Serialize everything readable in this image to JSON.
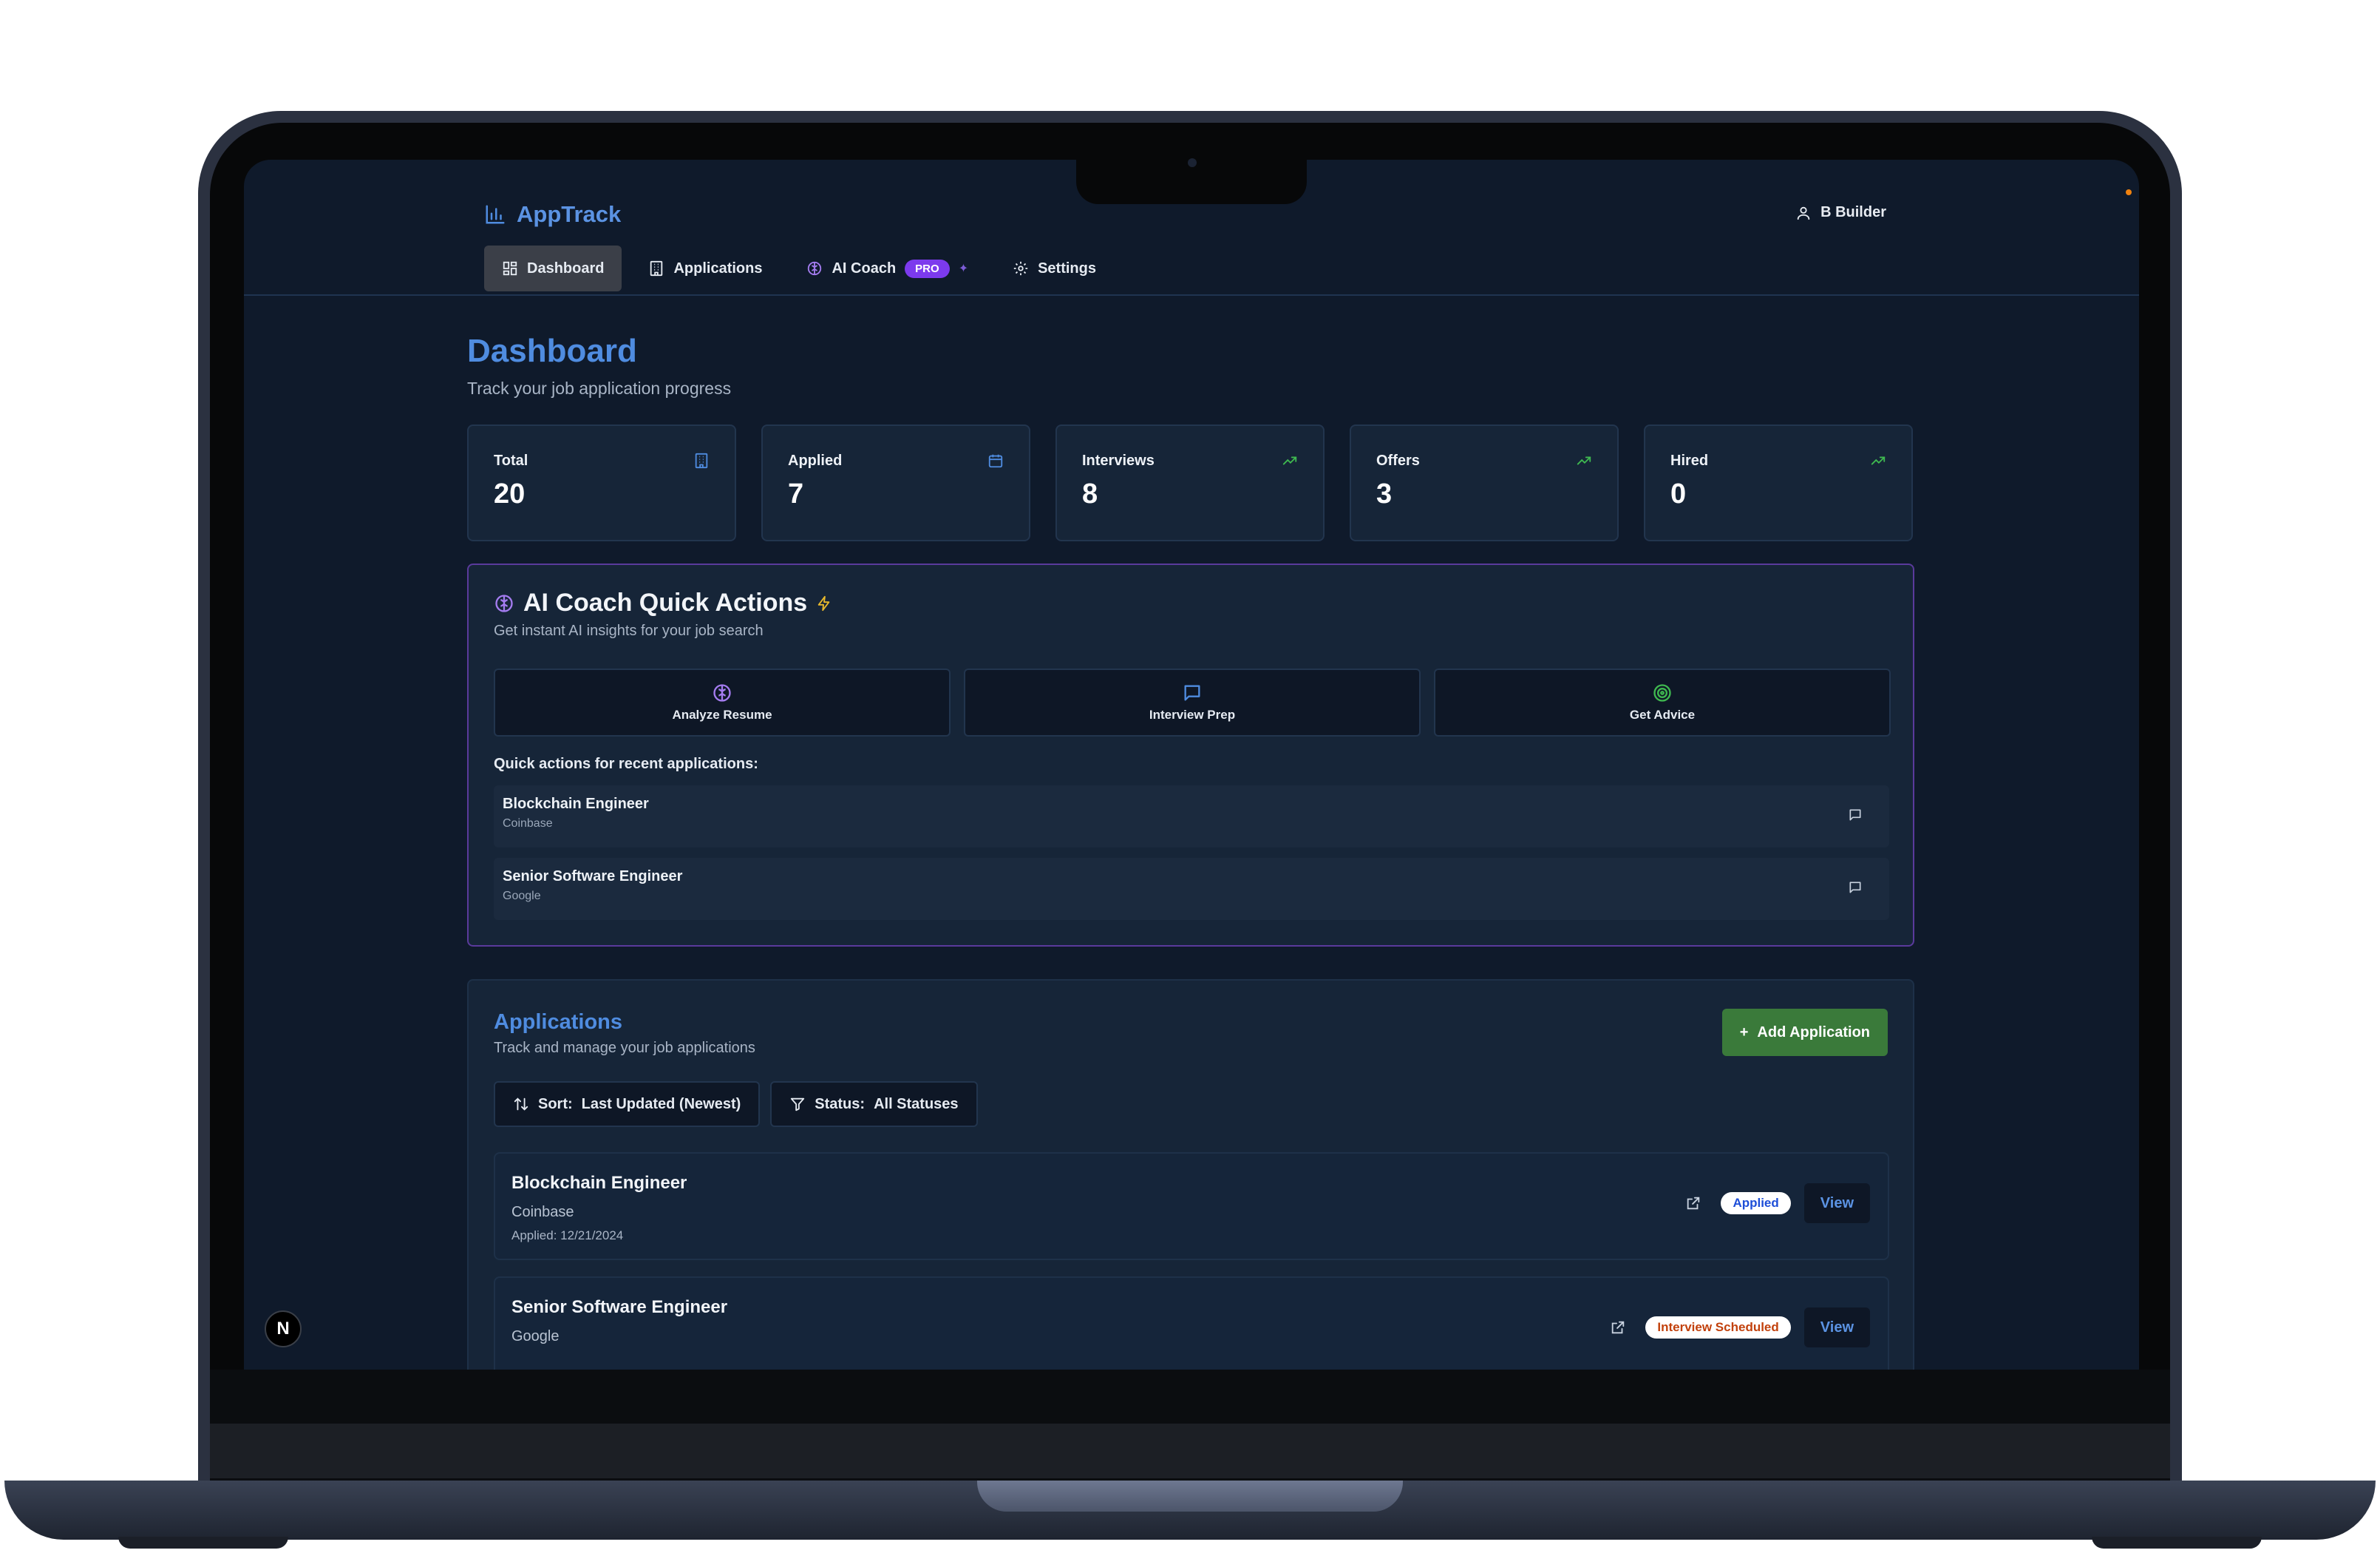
{
  "app": {
    "name": "AppTrack",
    "user_name": "B Builder"
  },
  "nav": {
    "items": [
      {
        "label": "Dashboard",
        "icon": "dashboard-grid-icon",
        "active": true
      },
      {
        "label": "Applications",
        "icon": "building-icon",
        "active": false
      },
      {
        "label": "AI Coach",
        "icon": "brain-icon",
        "badge": "PRO",
        "active": false
      },
      {
        "label": "Settings",
        "icon": "gear-icon",
        "active": false
      }
    ]
  },
  "page": {
    "title": "Dashboard",
    "subtitle": "Track your job application progress"
  },
  "stats": [
    {
      "label": "Total",
      "value": "20",
      "icon": "building-icon",
      "icon_color": "#4f8ce0"
    },
    {
      "label": "Applied",
      "value": "7",
      "icon": "calendar-icon",
      "icon_color": "#4f8ce0"
    },
    {
      "label": "Interviews",
      "value": "8",
      "icon": "trending-up-icon",
      "icon_color": "#3fb950"
    },
    {
      "label": "Offers",
      "value": "3",
      "icon": "trending-up-icon",
      "icon_color": "#3fb950"
    },
    {
      "label": "Hired",
      "value": "0",
      "icon": "trending-up-icon",
      "icon_color": "#3fb950"
    }
  ],
  "coach": {
    "title": "AI Coach Quick Actions",
    "subtitle": "Get instant AI insights for your job search",
    "actions": [
      {
        "label": "Analyze Resume",
        "icon": "brain-icon",
        "color": "#a47cf0"
      },
      {
        "label": "Interview Prep",
        "icon": "message-square-icon",
        "color": "#4f8ce0"
      },
      {
        "label": "Get Advice",
        "icon": "target-icon",
        "color": "#3fb950"
      }
    ],
    "recent_label": "Quick actions for recent applications:",
    "recent": [
      {
        "title": "Blockchain Engineer",
        "company": "Coinbase"
      },
      {
        "title": "Senior Software Engineer",
        "company": "Google"
      }
    ]
  },
  "applications": {
    "title": "Applications",
    "subtitle": "Track and manage your job applications",
    "add_label": "Add Application",
    "sort_label": "Sort:",
    "sort_value": "Last Updated (Newest)",
    "status_label": "Status:",
    "status_value": "All Statuses",
    "items": [
      {
        "title": "Blockchain Engineer",
        "company": "Coinbase",
        "date": "Applied: 12/21/2024",
        "status": "Applied",
        "status_color": "#1d4ed8",
        "view_label": "View"
      },
      {
        "title": "Senior Software Engineer",
        "company": "Google",
        "date": "",
        "status": "Interview Scheduled",
        "status_color": "#c2410c",
        "view_label": "View"
      }
    ]
  },
  "overlay": {
    "nextjs_badge": "N"
  }
}
